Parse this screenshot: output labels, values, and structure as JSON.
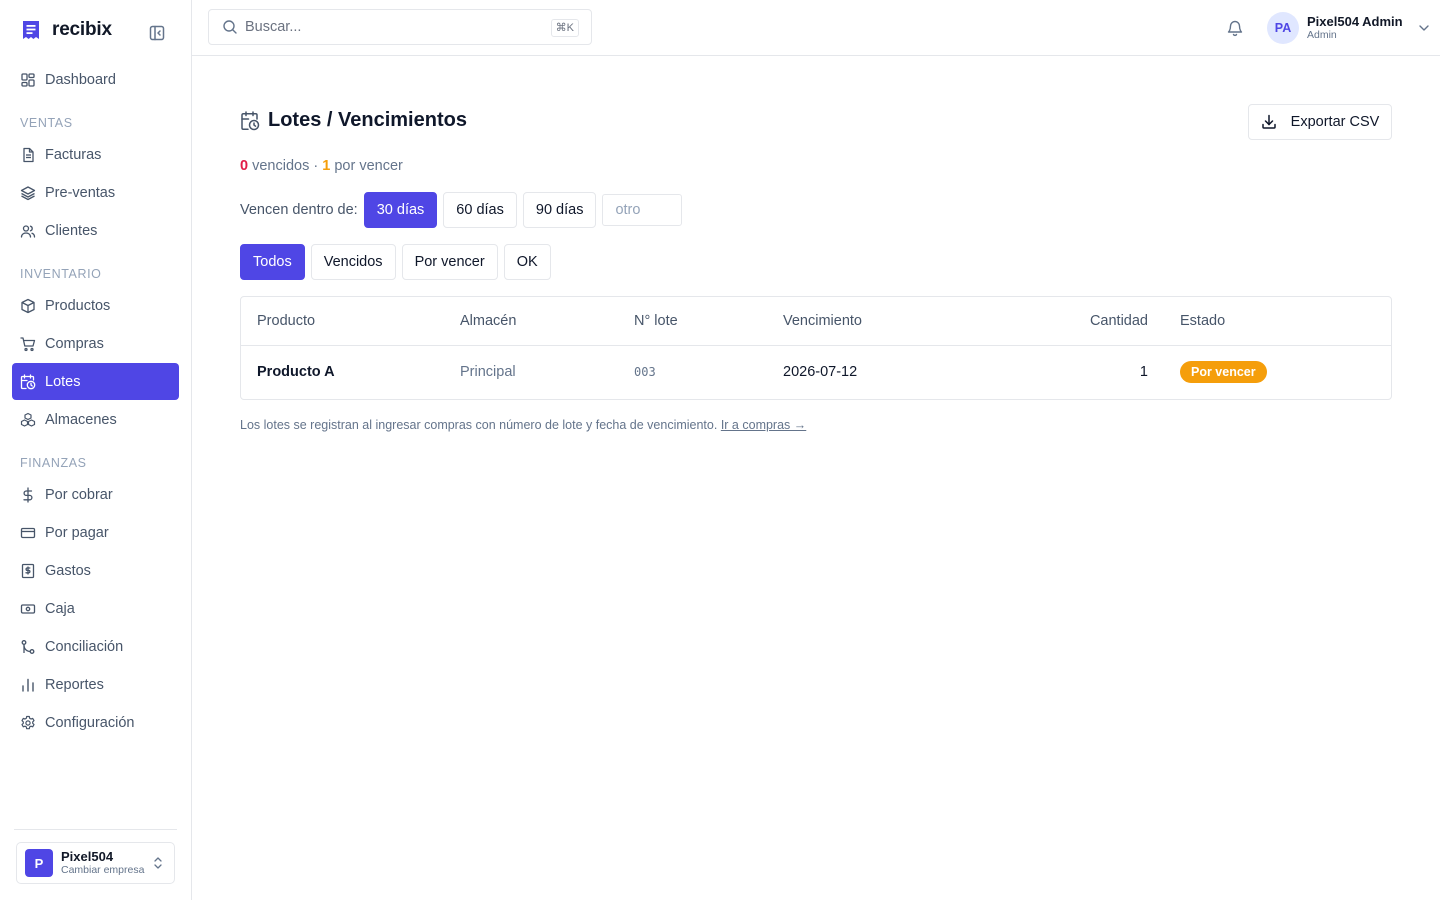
{
  "app": {
    "name": "recibix",
    "accent_color": "#4f46e5"
  },
  "sidebar": {
    "top_item": {
      "label": "Dashboard",
      "icon": "layout-dashboard-icon"
    },
    "sections": [
      {
        "title": "VENTAS",
        "items": [
          {
            "label": "Facturas",
            "icon": "file-text-icon"
          },
          {
            "label": "Pre-ventas",
            "icon": "layers-icon"
          },
          {
            "label": "Clientes",
            "icon": "users-icon"
          }
        ]
      },
      {
        "title": "INVENTARIO",
        "items": [
          {
            "label": "Productos",
            "icon": "package-icon"
          },
          {
            "label": "Compras",
            "icon": "shopping-cart-icon"
          },
          {
            "label": "Lotes",
            "icon": "calendar-clock-icon",
            "active": true
          },
          {
            "label": "Almacenes",
            "icon": "boxes-icon"
          }
        ]
      },
      {
        "title": "FINANZAS",
        "items": [
          {
            "label": "Por cobrar",
            "icon": "dollar-sign-icon"
          },
          {
            "label": "Por pagar",
            "icon": "credit-card-icon"
          },
          {
            "label": "Gastos",
            "icon": "receipt-icon"
          },
          {
            "label": "Caja",
            "icon": "banknote-icon"
          },
          {
            "label": "Conciliación",
            "icon": "git-merge-icon"
          },
          {
            "label": "Reportes",
            "icon": "bar-chart-icon"
          }
        ]
      }
    ],
    "settings_item": {
      "label": "Configuración",
      "icon": "settings-icon"
    },
    "company": {
      "initial": "P",
      "name": "Pixel504",
      "subtitle": "Cambiar empresa"
    }
  },
  "header": {
    "search_placeholder": "Buscar...",
    "search_shortcut": "⌘K",
    "user": {
      "initials": "PA",
      "name": "Pixel504 Admin",
      "role": "Admin"
    }
  },
  "page": {
    "title": "Lotes / Vencimientos",
    "export_label": "Exportar CSV",
    "summary": {
      "expired_count": "0",
      "expired_label": "vencidos",
      "separator": "·",
      "expiring_count": "1",
      "expiring_label": "por vencer"
    },
    "window_label": "Vencen dentro de:",
    "window_options": [
      "30 días",
      "60 días",
      "90 días"
    ],
    "window_active": "30 días",
    "window_custom_placeholder": "otro",
    "filters": [
      "Todos",
      "Vencidos",
      "Por vencer",
      "OK"
    ],
    "filter_active": "Todos",
    "table": {
      "columns": [
        "Producto",
        "Almacén",
        "N° lote",
        "Vencimiento",
        "Cantidad",
        "Estado"
      ],
      "rows": [
        {
          "producto": "Producto A",
          "almacen": "Principal",
          "lote": "003",
          "vencimiento": "2026-07-12",
          "cantidad": "1",
          "estado": "Por vencer",
          "estado_color": "#f59e0b"
        }
      ]
    },
    "footnote": "Los lotes se registran al ingresar compras con número de lote y fecha de vencimiento.",
    "footnote_link": "Ir a compras →"
  }
}
